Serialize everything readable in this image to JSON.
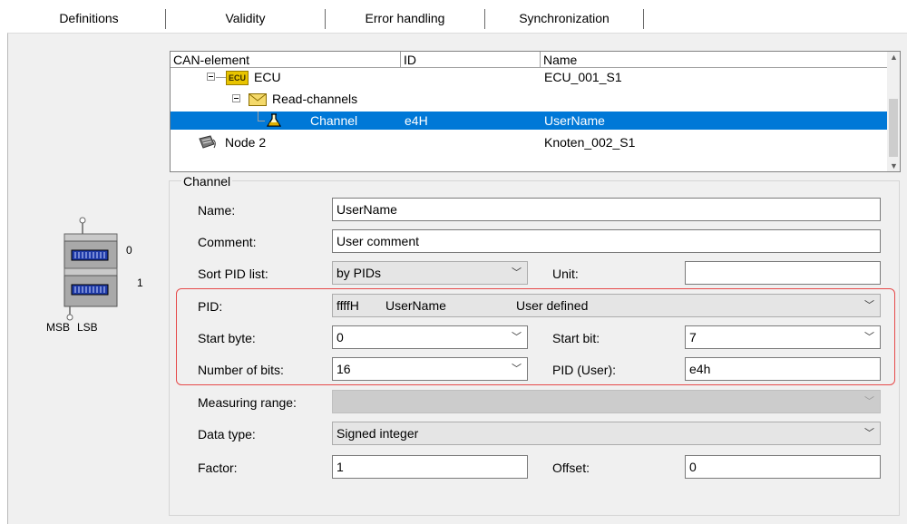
{
  "tabs": [
    {
      "label": "Definitions"
    },
    {
      "label": "Validity"
    },
    {
      "label": "Error handling"
    },
    {
      "label": "Synchronization"
    }
  ],
  "tree": {
    "columns": [
      "CAN-element",
      "ID",
      "Name"
    ],
    "rows": [
      {
        "label": "ECU",
        "badge": "ECU",
        "id": "",
        "name": "ECU_001_S1"
      },
      {
        "label": "Read-channels",
        "id": "",
        "name": ""
      },
      {
        "label": "Channel",
        "id": "e4H",
        "name": "UserName"
      },
      {
        "label": "Node 2",
        "id": "",
        "name": "Knoten_002_S1"
      }
    ]
  },
  "diagram": {
    "top_index": "0",
    "bottom_index": "1",
    "msb": "MSB",
    "lsb": "LSB"
  },
  "channel": {
    "group_title": "Channel",
    "name_label": "Name:",
    "name_value": "UserName",
    "comment_label": "Comment:",
    "comment_value": "User comment",
    "sort_label": "Sort PID list:",
    "sort_value": "by PIDs",
    "unit_label": "Unit:",
    "unit_value": "",
    "pid_label": "PID:",
    "pid_code": "ffffH",
    "pid_name": "UserName",
    "pid_type": "User defined",
    "start_byte_label": "Start byte:",
    "start_byte_value": "0",
    "start_bit_label": "Start bit:",
    "start_bit_value": "7",
    "num_bits_label": "Number of bits:",
    "num_bits_value": "16",
    "pid_user_label": "PID (User):",
    "pid_user_value": "e4h",
    "range_label": "Measuring range:",
    "range_value": "",
    "dtype_label": "Data type:",
    "dtype_value": "Signed integer",
    "factor_label": "Factor:",
    "factor_value": "1",
    "offset_label": "Offset:",
    "offset_value": "0"
  },
  "colors": {
    "selection": "#0078d7",
    "highlight_border": "#e64a4a"
  }
}
